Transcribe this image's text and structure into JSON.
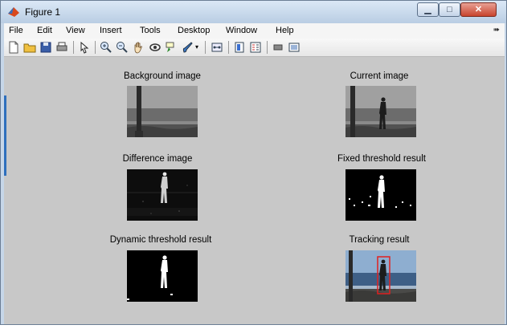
{
  "window": {
    "title": "Figure 1"
  },
  "menu": [
    "File",
    "Edit",
    "View",
    "Insert",
    "Tools",
    "Desktop",
    "Window",
    "Help"
  ],
  "toolbar": [
    "new-figure-icon",
    "open-file-icon",
    "save-icon",
    "print-icon",
    "select-arrow-icon",
    "zoom-in-icon",
    "zoom-out-icon",
    "pan-hand-icon",
    "rotate-3d-icon",
    "data-cursor-icon",
    "brush-icon",
    "link-plot-icon",
    "colorbar-icon",
    "legend-icon",
    "hide-plot-tools-icon",
    "show-plot-tools-icon"
  ],
  "panels": {
    "background": "Background image",
    "current": "Current image",
    "difference": "Difference image",
    "fixed": "Fixed threshold result",
    "dynamic": "Dynamic threshold result",
    "tracking": "Tracking result"
  },
  "colors": {
    "tracking_box": "#e02020",
    "canvas": "#c8c8c8"
  }
}
